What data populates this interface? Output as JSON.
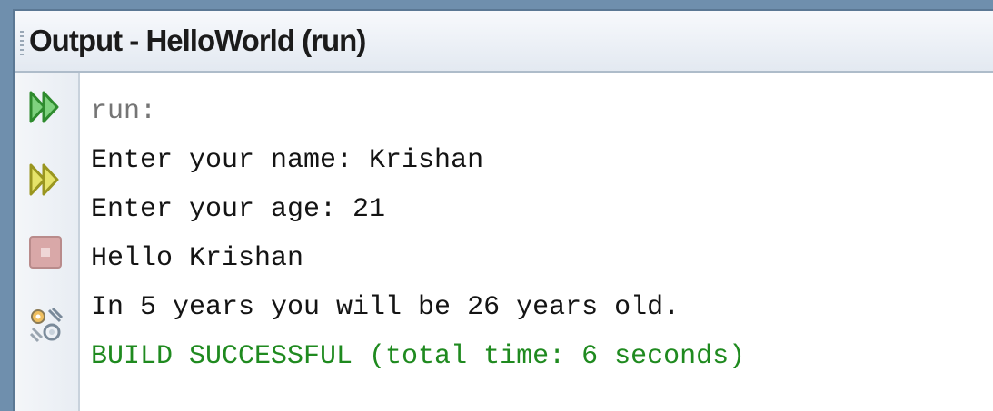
{
  "window": {
    "title": "Output - HelloWorld (run)"
  },
  "toolbar": [
    {
      "name": "rerun-icon",
      "label": ""
    },
    {
      "name": "rerun-with-args-icon",
      "label": ""
    },
    {
      "name": "stop-icon",
      "label": ""
    },
    {
      "name": "settings-icon",
      "label": ""
    }
  ],
  "output": {
    "lines": [
      "run:",
      "Enter your name: Krishan",
      "Enter your age: 21",
      "Hello Krishan",
      "In 5 years you will be 26 years old.",
      "BUILD SUCCESSFUL (total time: 6 seconds)"
    ]
  },
  "colors": {
    "run_prefix": "#757575",
    "build_success": "#1f8a1f",
    "rerun_icon": "#3aa53a",
    "rerun_args_icon": "#b8b531"
  }
}
